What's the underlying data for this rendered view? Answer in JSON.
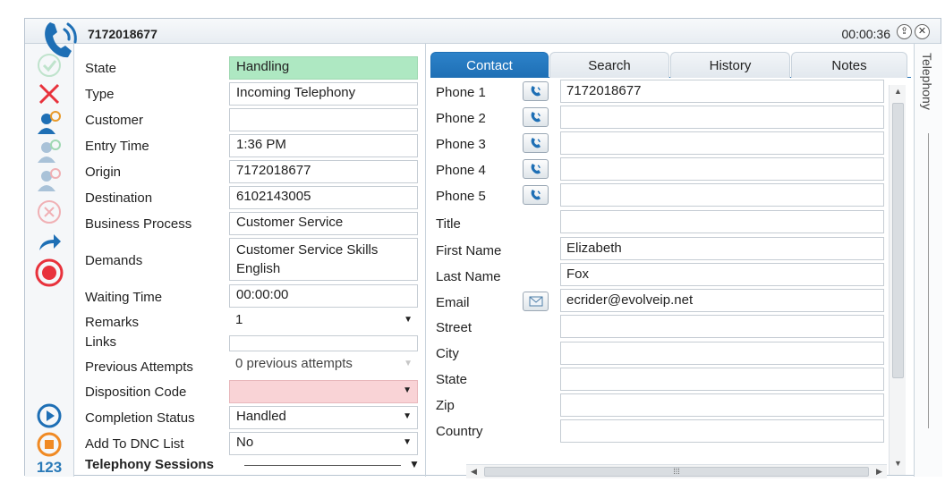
{
  "titlebar": {
    "number": "7172018677",
    "timer": "00:00:36",
    "pin_icon": "pin-icon",
    "close_icon": "close-icon"
  },
  "toolbar": {
    "items": [
      "checkmark-icon",
      "reject-x-icon",
      "customer-lookup-icon",
      "customer-add-icon",
      "customer-remove-icon",
      "cancel-circle-icon",
      "transfer-arrow-icon",
      "record-icon",
      "play-icon",
      "stop-icon"
    ],
    "keypad_label": "123"
  },
  "fields": [
    {
      "label": "State",
      "value": "Handling"
    },
    {
      "label": "Type",
      "value": "Incoming Telephony"
    },
    {
      "label": "Customer",
      "value": ""
    },
    {
      "label": "Entry Time",
      "value": "1:36 PM"
    },
    {
      "label": "Origin",
      "value": "7172018677"
    },
    {
      "label": "Destination",
      "value": "6102143005"
    },
    {
      "label": "Business Process",
      "value": "Customer Service"
    },
    {
      "label": "Demands",
      "value_line1": "Customer Service Skills",
      "value_line2": "English"
    },
    {
      "label": "Waiting Time",
      "value": "00:00:00"
    },
    {
      "label": "Remarks",
      "value": "1"
    },
    {
      "label": "Links",
      "value": ""
    },
    {
      "label": "Previous Attempts",
      "value": "0 previous attempts"
    },
    {
      "label": "Disposition Code",
      "value": ""
    },
    {
      "label": "Completion Status",
      "value": "Handled"
    },
    {
      "label": "Add To DNC List",
      "value": "No"
    }
  ],
  "sessions_title": "Telephony Sessions",
  "tabs": [
    "Contact",
    "Search",
    "History",
    "Notes"
  ],
  "contact": [
    {
      "label": "Phone 1",
      "value": "7172018677",
      "button": "phone-call-icon"
    },
    {
      "label": "Phone 2",
      "value": "",
      "button": "phone-call-icon"
    },
    {
      "label": "Phone 3",
      "value": "",
      "button": "phone-call-icon"
    },
    {
      "label": "Phone 4",
      "value": "",
      "button": "phone-call-icon"
    },
    {
      "label": "Phone 5",
      "value": "",
      "button": "phone-call-icon"
    },
    {
      "label": "Title",
      "value": ""
    },
    {
      "label": "First Name",
      "value": "Elizabeth"
    },
    {
      "label": "Last Name",
      "value": "Fox"
    },
    {
      "label": "Email",
      "value": "ecrider@evolveip.net",
      "button": "email-icon"
    },
    {
      "label": "Street",
      "value": ""
    },
    {
      "label": "City",
      "value": ""
    },
    {
      "label": "State",
      "value": ""
    },
    {
      "label": "Zip",
      "value": ""
    },
    {
      "label": "Country",
      "value": ""
    }
  ],
  "side_tab": "Telephony",
  "colors": {
    "accent": "#1e6fb5",
    "state_green": "#aee8c2",
    "disposition_pink": "#f9d3d6",
    "record_red": "#e8323c"
  }
}
